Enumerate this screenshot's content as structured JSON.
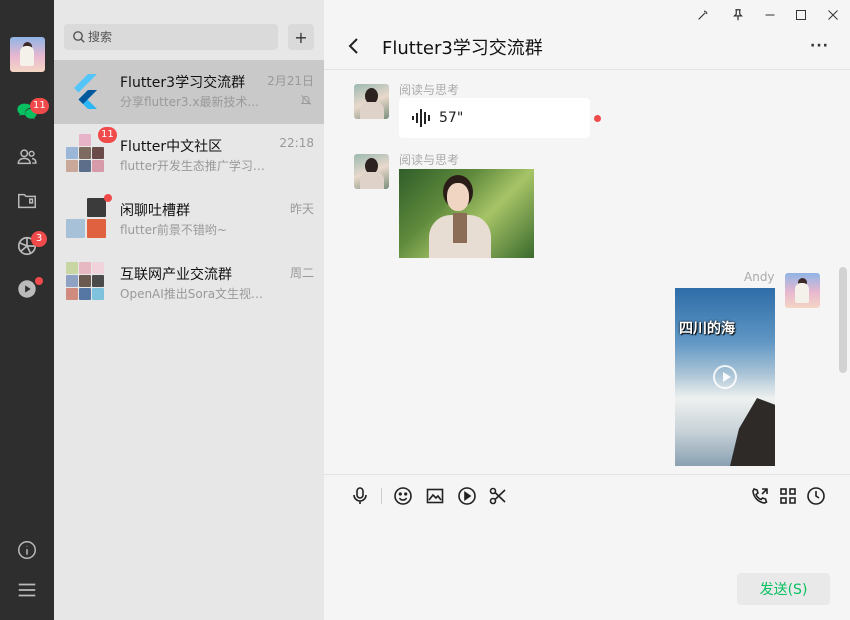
{
  "search": {
    "placeholder": "搜索"
  },
  "rail": {
    "chat_badge": "11",
    "moments_badge": "3"
  },
  "conversations": [
    {
      "name": "Flutter3学习交流群",
      "time": "2月21日",
      "preview": "分享flutter3.x最新技术...",
      "muted": true
    },
    {
      "name": "Flutter中文社区",
      "time": "22:18",
      "preview": "flutter开发生态推广学习交...",
      "badge": "11"
    },
    {
      "name": "闲聊吐槽群",
      "time": "昨天",
      "preview": "flutter前景不错哟~"
    },
    {
      "name": "互联网产业交流群",
      "time": "周二",
      "preview": "OpenAI推出Sora文生视频大..."
    }
  ],
  "chat": {
    "title": "Flutter3学习交流群",
    "more": "···",
    "messages": [
      {
        "sender": "阅读与思考",
        "type": "voice",
        "duration": "57\""
      },
      {
        "sender": "阅读与思考",
        "type": "image"
      },
      {
        "sender": "Andy",
        "type": "video",
        "caption": "四川的海"
      }
    ],
    "send_label": "发送(S)"
  },
  "colors": {
    "accent": "#07c160",
    "badge": "#f04a4a",
    "rail": "#2e2e2e"
  }
}
